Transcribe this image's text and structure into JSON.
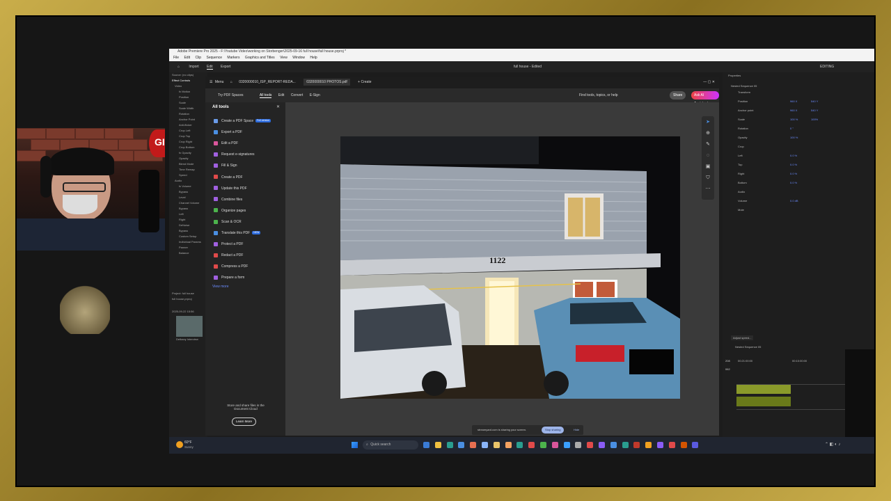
{
  "premiere": {
    "title": "Adobe Premiere Pro 2025 - F:\\Youtube Video\\working on Storbenger\\2025-09-16 full house\\full house.prproj *",
    "menu": [
      "File",
      "Edit",
      "Clip",
      "Sequence",
      "Markers",
      "Graphics and Titles",
      "View",
      "Window",
      "Help"
    ],
    "tabs": [
      "Import",
      "Edit",
      "Export"
    ],
    "center_title": "full house - Edited",
    "workspace": "EDITING",
    "panel_tabs": [
      "Source: (no clips)",
      "Effect Controls",
      "Audio Clip Mix",
      "Program: Sequence 06"
    ],
    "effect_rows": [
      "Video",
      "fx Motion",
      "Position",
      "Scale",
      "Scale Width",
      "Rotation",
      "Anchor Point",
      "Anti-flicker",
      "Crop Left",
      "Crop Top",
      "Crop Right",
      "Crop Bottom",
      "fx Opacity",
      "Opacity",
      "Blend Mode",
      "Time Remap",
      "Speed",
      "Audio",
      "fx Volume",
      "Bypass",
      "Level",
      "Channel Volume",
      "Bypass",
      "Left",
      "Right",
      "DeNoise",
      "Bypass",
      "Custom Setup",
      "Individual Params",
      "Panner",
      "Balance"
    ],
    "project_label": "Project: full house",
    "project_item": "full house.prproj",
    "project_file": "2025-09-22 15:56",
    "bin_label": "Delbany Interview",
    "properties_title": "Properties",
    "properties_seq": "Nested Sequence 05",
    "prop_rows": [
      {
        "label": "Transform",
        "v": "",
        "v2": ""
      },
      {
        "label": "Position",
        "v": "960 X",
        "v2": "540 Y"
      },
      {
        "label": "Anchor point",
        "v": "960 X",
        "v2": "540 Y"
      },
      {
        "label": "Scale",
        "v": "100 %",
        "v2": "100%"
      },
      {
        "label": "Rotation",
        "v": "0 °",
        "v2": ""
      },
      {
        "label": "Opacity",
        "v": "100 %",
        "v2": ""
      },
      {
        "label": "Crop",
        "v": "",
        "v2": ""
      },
      {
        "label": "Left",
        "v": "0.0 %",
        "v2": ""
      },
      {
        "label": "Top",
        "v": "0.0 %",
        "v2": ""
      },
      {
        "label": "Right",
        "v": "0.0 %",
        "v2": ""
      },
      {
        "label": "Bottom",
        "v": "0.0 %",
        "v2": ""
      },
      {
        "label": "Audio",
        "v": "",
        "v2": ""
      },
      {
        "label": "Volume",
        "v": "0.0 dB",
        "v2": ""
      },
      {
        "label": "Mute",
        "v": "",
        "v2": ""
      }
    ],
    "adjust_speed": "Adjust speed...",
    "timeline_seq": "Nested Sequence 05",
    "timecode": "00:10:00:00",
    "timeline_ruler": "00:21:00:00",
    "metrics": [
      "208",
      "062"
    ]
  },
  "acrobat": {
    "menu_label": "Menu",
    "tabs": [
      "0320000010_ISP_REPORT-REDA...",
      "0320000010 PHOTOS.pdf"
    ],
    "create_tab": "+ Create",
    "toolbar_left": "Try PDF Spaces",
    "toolbar_tabs": [
      "All tools",
      "Edit",
      "Convert",
      "E-Sign"
    ],
    "find_placeholder": "Find tools, topics, or help",
    "share_label": "Share",
    "assistant_label": "Ask AI Assistant",
    "panel_title": "All tools",
    "tools": [
      {
        "label": "Create a PDF Space",
        "badge": "Full version",
        "color": "#6a9be8"
      },
      {
        "label": "Export a PDF",
        "badge": "",
        "color": "#4a8fe2"
      },
      {
        "label": "Edit a PDF",
        "badge": "",
        "color": "#d9569c"
      },
      {
        "label": "Request e-signatures",
        "badge": "",
        "color": "#a060e0"
      },
      {
        "label": "Fill & Sign",
        "badge": "",
        "color": "#a060e0"
      },
      {
        "label": "Create a PDF",
        "badge": "",
        "color": "#e04a4a"
      },
      {
        "label": "Update this PDF",
        "badge": "",
        "color": "#a060e0"
      },
      {
        "label": "Combine files",
        "badge": "",
        "color": "#a060e0"
      },
      {
        "label": "Organize pages",
        "badge": "",
        "color": "#4cb34c"
      },
      {
        "label": "Scan & OCR",
        "badge": "",
        "color": "#4cb34c"
      },
      {
        "label": "Translate this PDF",
        "badge": "NEW",
        "color": "#4a8fe2"
      },
      {
        "label": "Protect a PDF",
        "badge": "",
        "color": "#a060e0"
      },
      {
        "label": "Redact a PDF",
        "badge": "",
        "color": "#e04a4a"
      },
      {
        "label": "Compress a PDF",
        "badge": "",
        "color": "#e04a4a"
      },
      {
        "label": "Prepare a form",
        "badge": "",
        "color": "#a060e0"
      }
    ],
    "view_more": "View more",
    "cloud_text": "Store and share files in the Document Cloud",
    "learn_more": "Learn More",
    "house_number": "1122"
  },
  "share_bar": {
    "text": "streamyard.com is sharing your screen.",
    "stop_label": "Stop sharing",
    "hide_label": "Hide"
  },
  "taskbar": {
    "weather_temp": "60°F",
    "weather_desc": "Sunny",
    "search_placeholder": "Quick search"
  },
  "webcam": {
    "sign_text": "GI"
  }
}
